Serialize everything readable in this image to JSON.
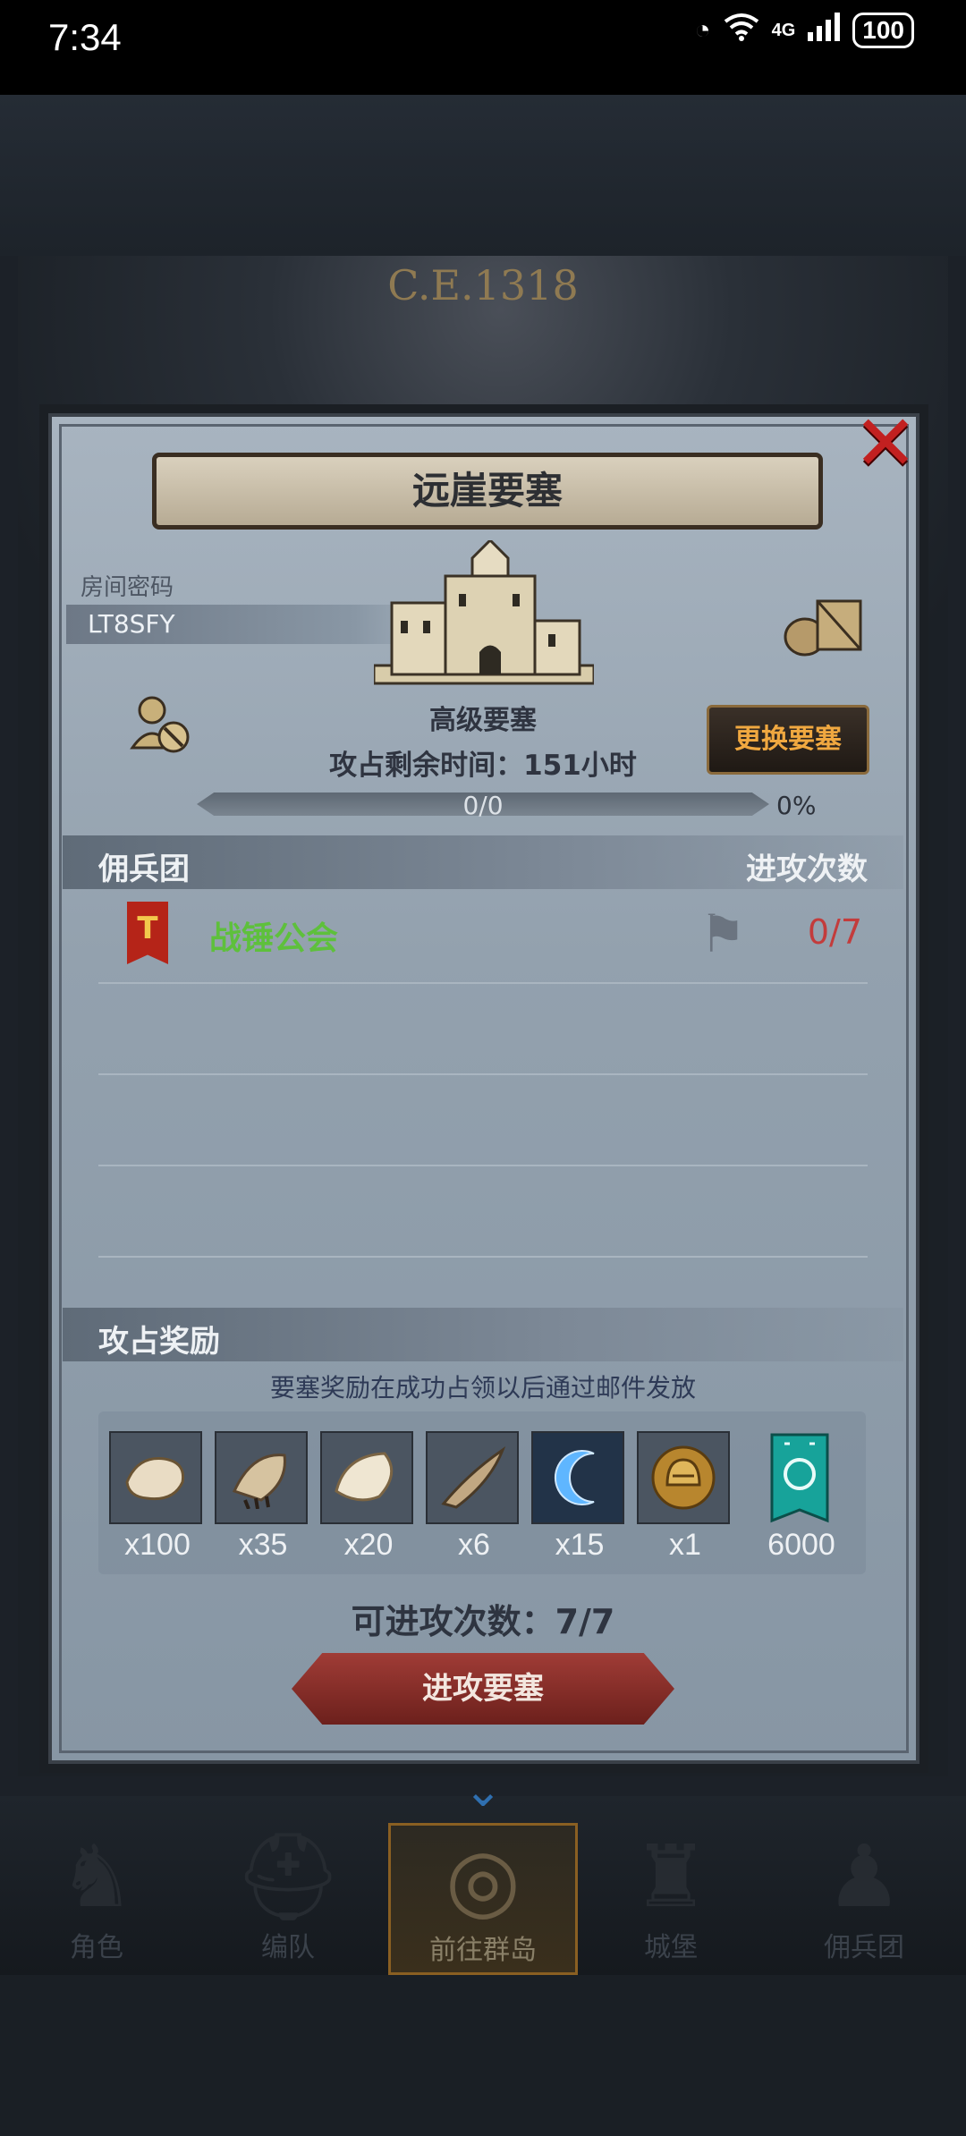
{
  "status": {
    "time": "7:34",
    "network": "4G",
    "battery": "100"
  },
  "era": "C.E.1318",
  "title": "远崖要塞",
  "room": {
    "label": "房间密码",
    "code": "LT8SFY"
  },
  "fortress": {
    "type": "高级要塞",
    "change_label": "更换要塞",
    "time_left": "攻占剩余时间：151小时",
    "progress_text": "0/0",
    "progress_pct": "0%",
    "progress_value": 0
  },
  "mercenary": {
    "header": "佣兵团",
    "attacks_header": "进攻次数",
    "guild_name": "战锤公会",
    "guild_attacks": "0/7"
  },
  "rewards": {
    "header": "攻占奖励",
    "note": "要塞奖励在成功占领以后通过邮件发放",
    "items": [
      {
        "icon": "fur-pelt-icon",
        "qty": "x100"
      },
      {
        "icon": "beast-claw-icon",
        "qty": "x35"
      },
      {
        "icon": "white-pelt-icon",
        "qty": "x20"
      },
      {
        "icon": "horn-icon",
        "qty": "x6"
      },
      {
        "icon": "blue-crescent-icon",
        "qty": "x15"
      },
      {
        "icon": "golden-helmet-icon",
        "qty": "x1"
      },
      {
        "icon": "teal-banner-icon",
        "qty": "6000"
      }
    ]
  },
  "available_attacks": "可进攻次数：7/7",
  "attack_button": "进攻要塞",
  "tabs": [
    {
      "label": "角色",
      "icon": "knight-icon"
    },
    {
      "label": "编队",
      "icon": "helmet-icon"
    },
    {
      "label": "前往群岛",
      "icon": "globe-icon",
      "active": true
    },
    {
      "label": "城堡",
      "icon": "castle-icon"
    },
    {
      "label": "佣兵团",
      "icon": "warrior-icon"
    }
  ]
}
